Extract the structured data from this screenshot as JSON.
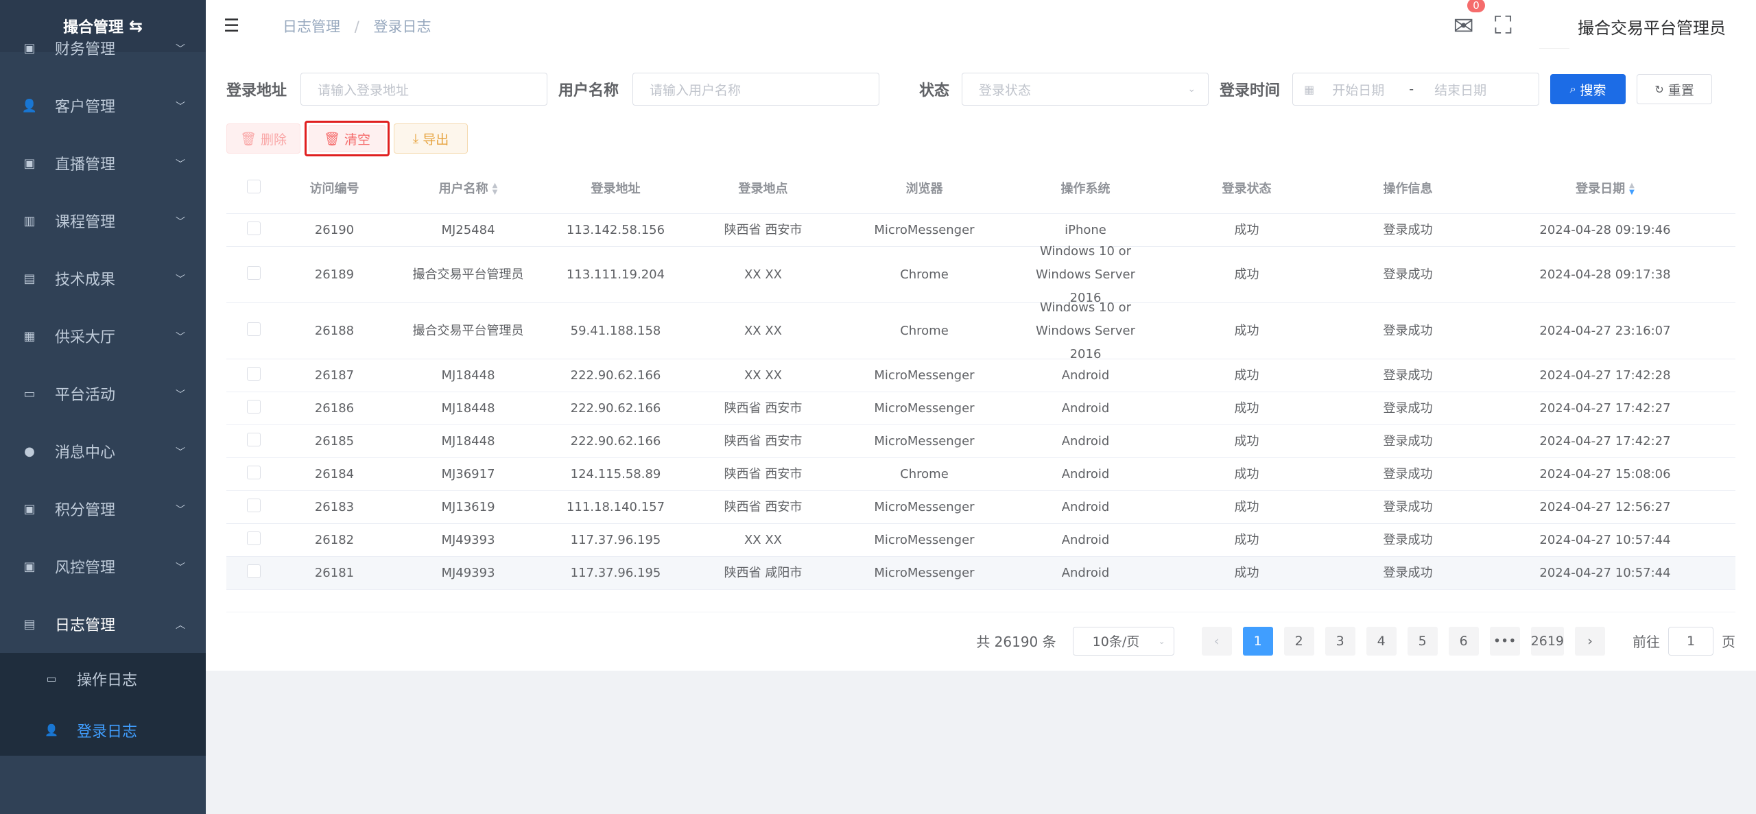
{
  "sidebar": {
    "logo": "撮合管理",
    "menu": [
      {
        "label": "财务管理",
        "icon": "finance-icon"
      },
      {
        "label": "客户管理",
        "icon": "user-icon"
      },
      {
        "label": "直播管理",
        "icon": "live-icon"
      },
      {
        "label": "课程管理",
        "icon": "book-icon"
      },
      {
        "label": "技术成果",
        "icon": "doc-icon"
      },
      {
        "label": "供采大厅",
        "icon": "building-icon"
      },
      {
        "label": "平台活动",
        "icon": "monitor-icon"
      },
      {
        "label": "消息中心",
        "icon": "message-icon"
      },
      {
        "label": "积分管理",
        "icon": "score-icon"
      },
      {
        "label": "风控管理",
        "icon": "risk-icon"
      },
      {
        "label": "日志管理",
        "icon": "log-icon"
      }
    ],
    "submenu": [
      {
        "label": "操作日志",
        "icon": "briefcase-icon"
      },
      {
        "label": "登录日志",
        "icon": "user-icon"
      }
    ]
  },
  "header": {
    "breadcrumb": [
      "日志管理",
      "登录日志"
    ],
    "badge": "0",
    "username": "撮合交易平台管理员"
  },
  "search": {
    "addr_label": "登录地址",
    "addr_placeholder": "请输入登录地址",
    "user_label": "用户名称",
    "user_placeholder": "请输入用户名称",
    "status_label": "状态",
    "status_placeholder": "登录状态",
    "time_label": "登录时间",
    "start_placeholder": "开始日期",
    "dash": "-",
    "end_placeholder": "结束日期",
    "search_btn": "搜索",
    "reset_btn": "重置"
  },
  "actions": {
    "delete": "删除",
    "clear": "清空",
    "export": "导出"
  },
  "table": {
    "columns": [
      "访问编号",
      "用户名称",
      "登录地址",
      "登录地点",
      "浏览器",
      "操作系统",
      "登录状态",
      "操作信息",
      "登录日期"
    ],
    "rows": [
      [
        "26190",
        "MJ25484",
        "113.142.58.156",
        "陕西省 西安市",
        "MicroMessenger",
        "iPhone",
        "成功",
        "登录成功",
        "2024-04-28 09:19:46"
      ],
      [
        "26189",
        "撮合交易平台管理员",
        "113.111.19.204",
        "XX XX",
        "Chrome",
        "Windows 10 or Windows Server 2016",
        "成功",
        "登录成功",
        "2024-04-28 09:17:38"
      ],
      [
        "26188",
        "撮合交易平台管理员",
        "59.41.188.158",
        "XX XX",
        "Chrome",
        "Windows 10 or Windows Server 2016",
        "成功",
        "登录成功",
        "2024-04-27 23:16:07"
      ],
      [
        "26187",
        "MJ18448",
        "222.90.62.166",
        "XX XX",
        "MicroMessenger",
        "Android",
        "成功",
        "登录成功",
        "2024-04-27 17:42:28"
      ],
      [
        "26186",
        "MJ18448",
        "222.90.62.166",
        "陕西省 西安市",
        "MicroMessenger",
        "Android",
        "成功",
        "登录成功",
        "2024-04-27 17:42:27"
      ],
      [
        "26185",
        "MJ18448",
        "222.90.62.166",
        "陕西省 西安市",
        "MicroMessenger",
        "Android",
        "成功",
        "登录成功",
        "2024-04-27 17:42:27"
      ],
      [
        "26184",
        "MJ36917",
        "124.115.58.89",
        "陕西省 西安市",
        "Chrome",
        "Android",
        "成功",
        "登录成功",
        "2024-04-27 15:08:06"
      ],
      [
        "26183",
        "MJ13619",
        "111.18.140.157",
        "陕西省 西安市",
        "MicroMessenger",
        "Android",
        "成功",
        "登录成功",
        "2024-04-27 12:56:27"
      ],
      [
        "26182",
        "MJ49393",
        "117.37.96.195",
        "XX XX",
        "MicroMessenger",
        "Android",
        "成功",
        "登录成功",
        "2024-04-27 10:57:44"
      ],
      [
        "26181",
        "MJ49393",
        "117.37.96.195",
        "陕西省 咸阳市",
        "MicroMessenger",
        "Android",
        "成功",
        "登录成功",
        "2024-04-27 10:57:44"
      ]
    ]
  },
  "pagination": {
    "total": "共 26190 条",
    "page_size": "10条/页",
    "pages": [
      "1",
      "2",
      "3",
      "4",
      "5",
      "6",
      "•••",
      "2619"
    ],
    "goto_label": "前往",
    "goto_value": "1",
    "page_suffix": "页"
  }
}
